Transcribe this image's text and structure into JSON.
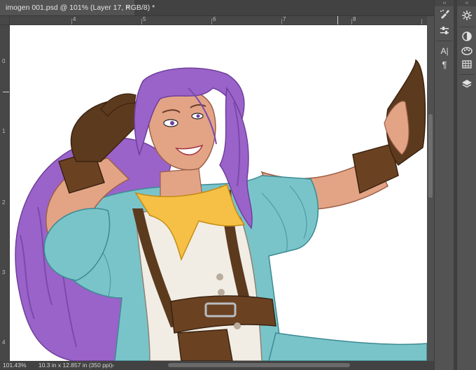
{
  "document": {
    "tab_title": "imogen 001.psd @ 101% (Layer 17, RGB/8) *",
    "tab_close": "×"
  },
  "ruler": {
    "top_labels": [
      "4",
      "5",
      "6",
      "7",
      "8"
    ],
    "left_labels": [
      "0",
      "1",
      "2",
      "3",
      "4"
    ]
  },
  "status": {
    "zoom": "101.43%",
    "doc_info": "10.3 in x 12.857 in (350 ppi)",
    "arrow": "›"
  },
  "panels": {
    "collapse_left": "‹‹",
    "collapse_right": "‹‹",
    "tools_left": [
      "brush-settings-icon",
      "adjust-sliders-icon",
      "character-icon",
      "paragraph-icon"
    ],
    "tools_right": [
      "color-wheel-icon",
      "adjustments-icon",
      "swatches-icon",
      "table-icon",
      "layers-icon"
    ],
    "character_glyph": "A|",
    "paragraph_glyph": "¶"
  },
  "colors": {
    "hair": "#9a63c9",
    "skin": "#e3a486",
    "shirt": "#79c4c9",
    "vest": "#f1ede5",
    "scarf": "#f5c045",
    "leather": "#5c3a1e"
  }
}
